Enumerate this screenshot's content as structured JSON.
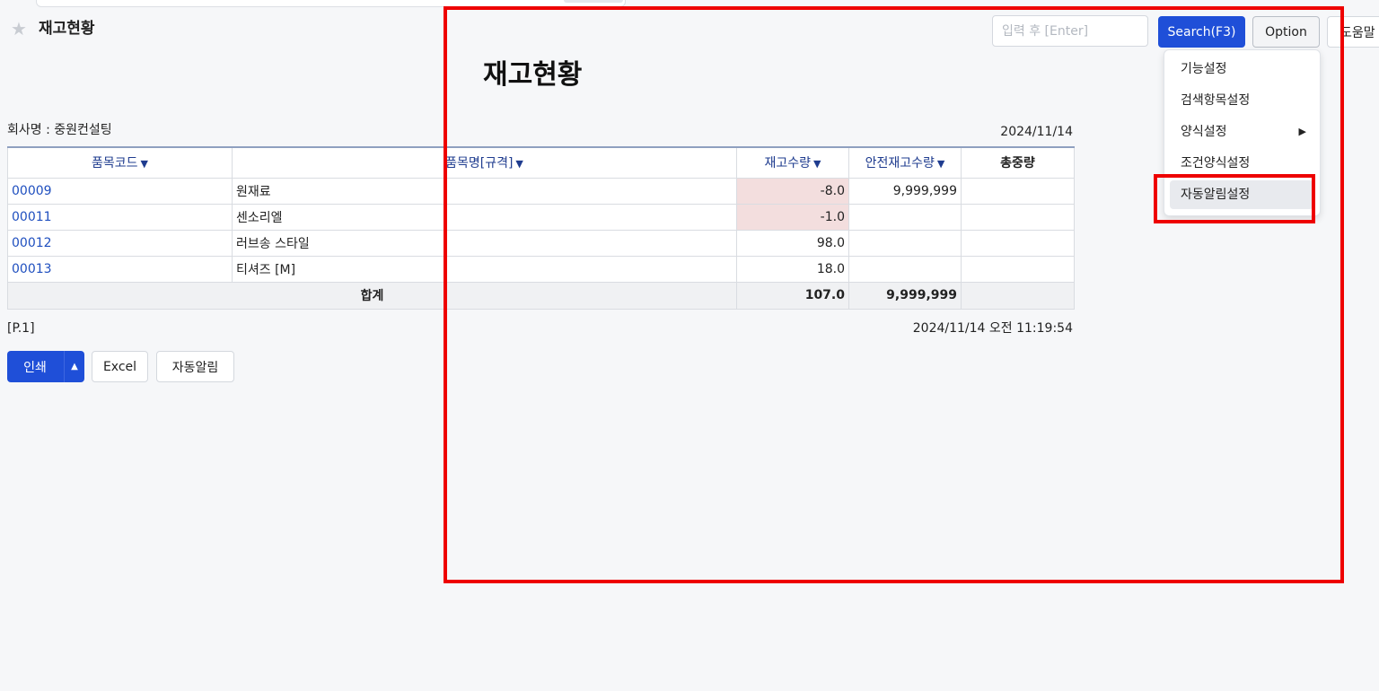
{
  "header": {
    "title": "재고현황",
    "search_placeholder": "입력 후 [Enter]",
    "search_button": "Search(F3)",
    "option_button": "Option",
    "help_button": "도움말"
  },
  "option_menu": {
    "items": [
      {
        "label": "기능설정"
      },
      {
        "label": "검색항목설정"
      },
      {
        "label": "양식설정",
        "submenu_arrow": "▶"
      },
      {
        "label": "조건양식설정"
      },
      {
        "label": "자동알림설정"
      }
    ]
  },
  "report": {
    "title": "재고현황",
    "company": "회사명 : 중원컨설팅",
    "date": "2024/11/14",
    "columns": [
      {
        "label": "품목코드",
        "sort": "▼"
      },
      {
        "label": "품목명[규격]",
        "sort": "▼"
      },
      {
        "label": "재고수량",
        "sort": "▼"
      },
      {
        "label": "안전재고수량",
        "sort": "▼"
      },
      {
        "label": "총중량",
        "sort": ""
      }
    ],
    "rows": [
      {
        "code": "00009",
        "name": "원재료",
        "qty": "-8.0",
        "safety": "9,999,999",
        "weight": ""
      },
      {
        "code": "00011",
        "name": "센소리엘",
        "qty": "-1.0",
        "safety": "",
        "weight": ""
      },
      {
        "code": "00012",
        "name": "러브송 스타일",
        "qty": "98.0",
        "safety": "",
        "weight": ""
      },
      {
        "code": "00013",
        "name": "티셔즈 [M]",
        "qty": "18.0",
        "safety": "",
        "weight": ""
      }
    ],
    "total": {
      "label": "합계",
      "qty": "107.0",
      "safety": "9,999,999",
      "weight": ""
    },
    "page": "[P.1]",
    "printed_at": "2024/11/14 오전 11:19:54"
  },
  "footer_buttons": {
    "print": "인쇄",
    "print_caret": "▲",
    "excel": "Excel",
    "alarm": "자동알림"
  },
  "colors": {
    "primary": "#1f4fd8",
    "highlight": "#ee0000",
    "negative_cell": "#f3dede"
  }
}
